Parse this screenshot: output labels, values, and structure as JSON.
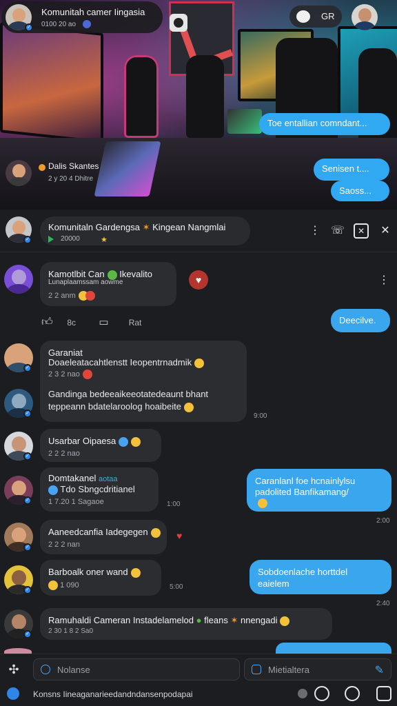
{
  "hero": {
    "title": "Komunitah camer Iingasia",
    "subtitle": "0100 20 ao",
    "action_label": "GR",
    "caption_name": "Dalis Skantes",
    "caption_meta": "2 y 20 4 Dhitre",
    "bubbles": [
      "Toe entallian comndant...",
      "Senisen t....",
      "Saoss..."
    ]
  },
  "chat_header": {
    "title": "Komunitaln Gardengsa",
    "title_suffix": "Kingean Nangmlai",
    "subtitle": "20000"
  },
  "messages": [
    {
      "name": "Kamotlbit Can",
      "name_suffix": "Ikevalito",
      "lines": [
        "Lunaplaamssam aowme"
      ],
      "meta": "2 2 anm"
    },
    {
      "name": "Garaniat",
      "lines": [
        "Doaeleatacahtlenstt Ieopentrnadmik",
        "",
        "Gandinga bedeeaikeeotatedeaunt bhant",
        "teppeann bdatelaroolog hoaibeite"
      ],
      "meta": "2 3 2 nao",
      "time": "9:00"
    },
    {
      "name": "Usarbar Oipaesa",
      "lines": [],
      "meta": "2 2 2 nao"
    },
    {
      "name": "Domtakanel",
      "name_suffix": "aotaa",
      "lines": [
        "Tdo  Sbngcdritianel"
      ],
      "meta": "1  7.20 1 Sagaoe",
      "time": "1:00"
    },
    {
      "name": "Aaneedcanfia Iadegegen",
      "lines": [],
      "meta": "2 2 2 nan"
    },
    {
      "name": "Barboalk oner wand",
      "lines": [],
      "meta": "1  090",
      "time": "5:00"
    },
    {
      "name": "Ramuhaldi Cameran Instadelamelod",
      "name_suffix": "fleans",
      "name_tail": "nnengadi",
      "lines": [],
      "meta": "2 30 1 8 2 Sa0"
    }
  ],
  "reactions": {
    "like_count": "8c",
    "reply_label": "Rat"
  },
  "outgoing": [
    {
      "lines": [
        "Deecilve."
      ]
    },
    {
      "lines": [
        "Caranlanl foe hcnainlylsu",
        "padolited Banfikamang/"
      ],
      "time": "2:00"
    },
    {
      "lines": [
        "Sobdoenlache horttdel",
        "eaielem"
      ],
      "time": "2:40"
    }
  ],
  "input": {
    "placeholder_left": "Nolanse",
    "placeholder_right": "Mietialtera",
    "bottom_text": "Konsns Iineaganarieedandndansenpodapai"
  },
  "colors": {
    "accent": "#30a9f2",
    "bg": "#1c1d20",
    "bubble": "#2c2d31"
  }
}
